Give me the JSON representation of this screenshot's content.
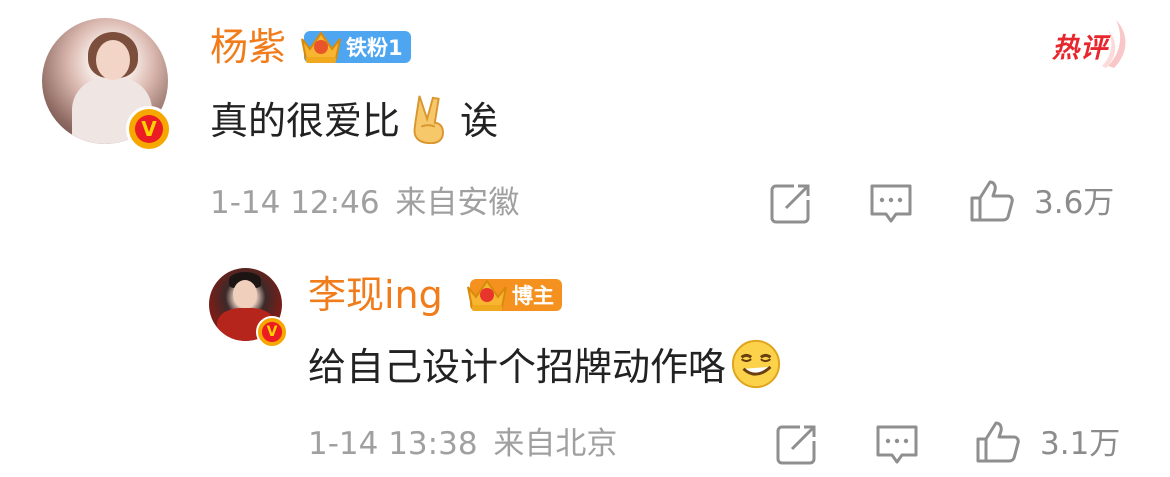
{
  "comment": {
    "author": "杨紫",
    "fan_badge": "铁粉1",
    "hot_label": "热评",
    "text_before": "真的很爱比",
    "emoji": "victory-hand",
    "text_after": "诶",
    "date": "1-14 12:46",
    "location": "来自安徽",
    "like_count": "3.6万",
    "colors": {
      "name": "#f07c1c",
      "hot": "#e8262d",
      "fan_badge": "#4fa6f0"
    }
  },
  "reply": {
    "author": "李现ing",
    "badge": "博主",
    "text": "给自己设计个招牌动作咯",
    "emoji": "smirk-face",
    "date": "1-14 13:38",
    "location": "来自北京",
    "like_count": "3.1万",
    "colors": {
      "badge": "#f5911f"
    }
  }
}
